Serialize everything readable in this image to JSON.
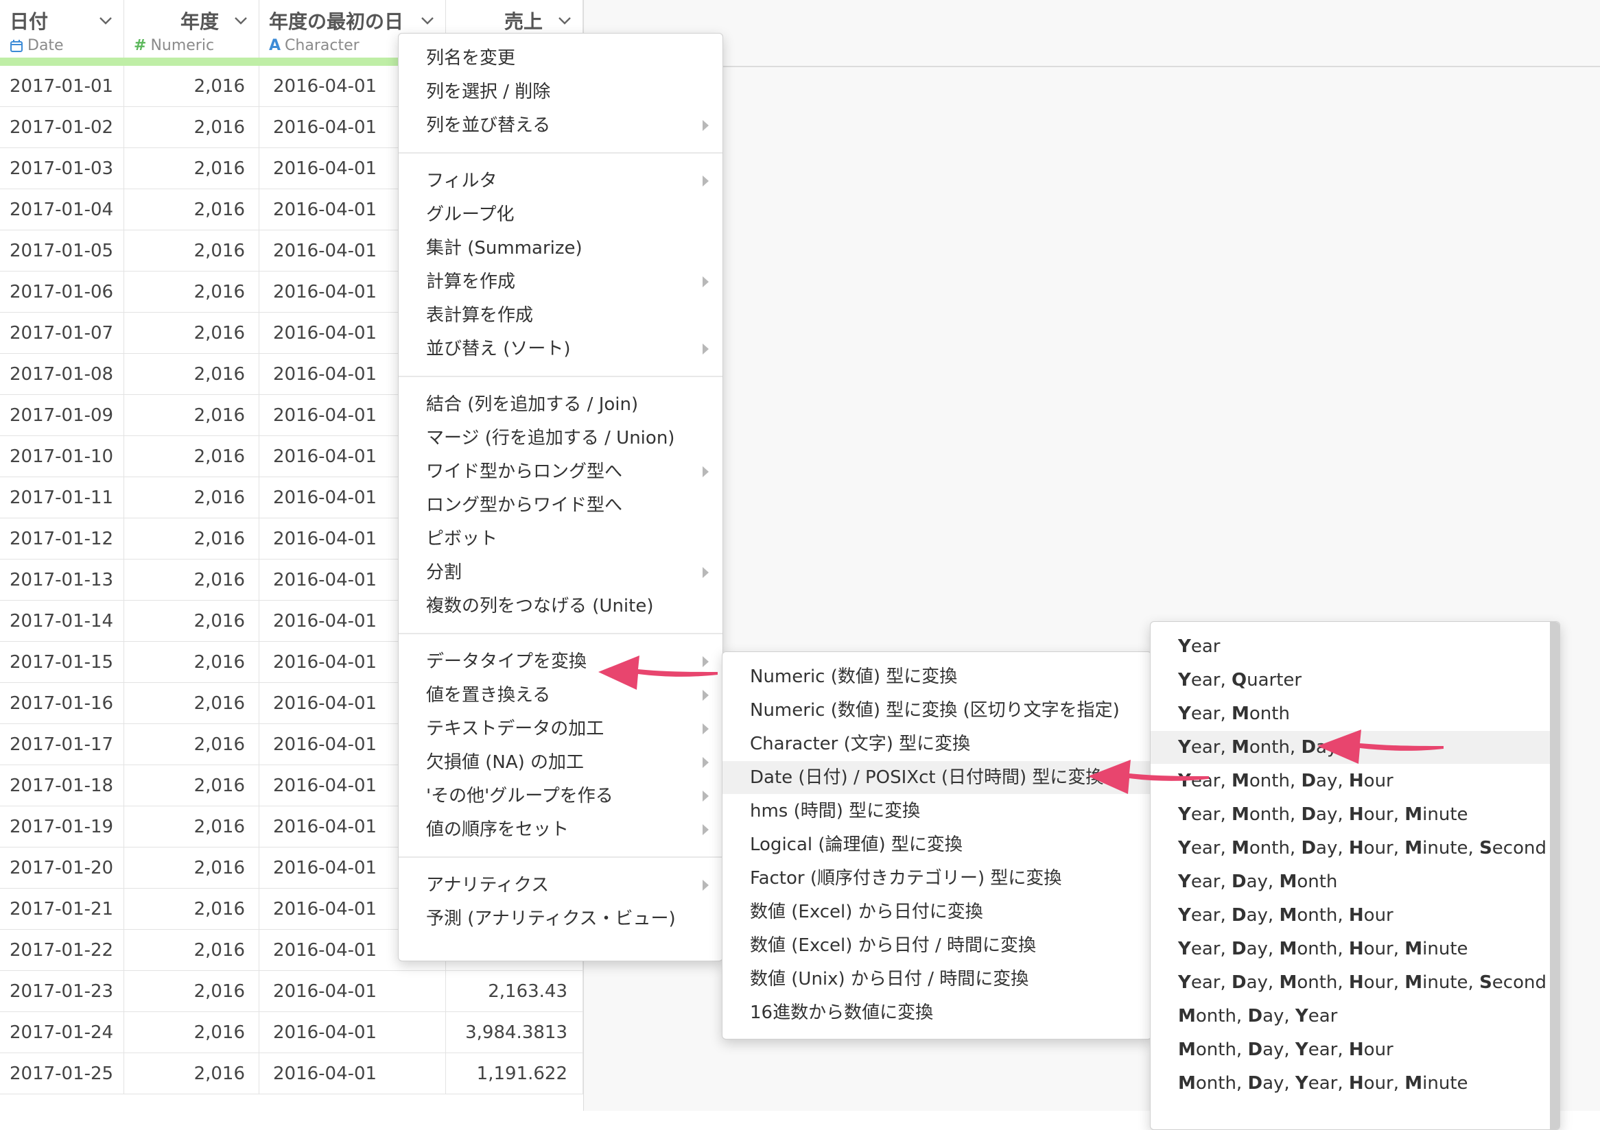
{
  "table": {
    "columns": [
      {
        "name": "日付",
        "type": "Date",
        "type_icon": "calendar-icon"
      },
      {
        "name": "年度",
        "type": "Numeric",
        "type_icon": "hash-icon"
      },
      {
        "name": "年度の最初の日",
        "type": "Character",
        "type_icon": "character-a-icon"
      },
      {
        "name": "売上",
        "type": ""
      }
    ],
    "rows": [
      [
        "2017-01-01",
        "2,016",
        "2016-04-01",
        ""
      ],
      [
        "2017-01-02",
        "2,016",
        "2016-04-01",
        ""
      ],
      [
        "2017-01-03",
        "2,016",
        "2016-04-01",
        ""
      ],
      [
        "2017-01-04",
        "2,016",
        "2016-04-01",
        ""
      ],
      [
        "2017-01-05",
        "2,016",
        "2016-04-01",
        ""
      ],
      [
        "2017-01-06",
        "2,016",
        "2016-04-01",
        ""
      ],
      [
        "2017-01-07",
        "2,016",
        "2016-04-01",
        ""
      ],
      [
        "2017-01-08",
        "2,016",
        "2016-04-01",
        ""
      ],
      [
        "2017-01-09",
        "2,016",
        "2016-04-01",
        ""
      ],
      [
        "2017-01-10",
        "2,016",
        "2016-04-01",
        ""
      ],
      [
        "2017-01-11",
        "2,016",
        "2016-04-01",
        ""
      ],
      [
        "2017-01-12",
        "2,016",
        "2016-04-01",
        ""
      ],
      [
        "2017-01-13",
        "2,016",
        "2016-04-01",
        ""
      ],
      [
        "2017-01-14",
        "2,016",
        "2016-04-01",
        ""
      ],
      [
        "2017-01-15",
        "2,016",
        "2016-04-01",
        ""
      ],
      [
        "2017-01-16",
        "2,016",
        "2016-04-01",
        ""
      ],
      [
        "2017-01-17",
        "2,016",
        "2016-04-01",
        ""
      ],
      [
        "2017-01-18",
        "2,016",
        "2016-04-01",
        ""
      ],
      [
        "2017-01-19",
        "2,016",
        "2016-04-01",
        ""
      ],
      [
        "2017-01-20",
        "2,016",
        "2016-04-01",
        ""
      ],
      [
        "2017-01-21",
        "2,016",
        "2016-04-01",
        ""
      ],
      [
        "2017-01-22",
        "2,016",
        "2016-04-01",
        ""
      ],
      [
        "2017-01-23",
        "2,016",
        "2016-04-01",
        "2,163.43"
      ],
      [
        "2017-01-24",
        "2,016",
        "2016-04-01",
        "3,984.3813"
      ],
      [
        "2017-01-25",
        "2,016",
        "2016-04-01",
        "1,191.622"
      ]
    ]
  },
  "column_menu": {
    "groups": [
      [
        {
          "label": "列名を変更",
          "submenu": false
        },
        {
          "label": "列を選択 / 削除",
          "submenu": false
        },
        {
          "label": "列を並び替える",
          "submenu": true
        }
      ],
      [
        {
          "label": "フィルタ",
          "submenu": true
        },
        {
          "label": "グループ化",
          "submenu": false
        },
        {
          "label": "集計 (Summarize)",
          "submenu": false
        },
        {
          "label": "計算を作成",
          "submenu": true
        },
        {
          "label": "表計算を作成",
          "submenu": false
        },
        {
          "label": "並び替え (ソート)",
          "submenu": true
        }
      ],
      [
        {
          "label": "結合 (列を追加する / Join)",
          "submenu": false
        },
        {
          "label": "マージ (行を追加する / Union)",
          "submenu": false
        },
        {
          "label": "ワイド型からロング型へ",
          "submenu": true
        },
        {
          "label": "ロング型からワイド型へ",
          "submenu": false
        },
        {
          "label": "ピボット",
          "submenu": false
        },
        {
          "label": "分割",
          "submenu": true
        },
        {
          "label": "複数の列をつなげる (Unite)",
          "submenu": false
        }
      ],
      [
        {
          "label": "データタイプを変換",
          "submenu": true
        },
        {
          "label": "値を置き換える",
          "submenu": true
        },
        {
          "label": "テキストデータの加工",
          "submenu": true
        },
        {
          "label": "欠損値 (NA) の加工",
          "submenu": true
        },
        {
          "label": "'その他'グループを作る",
          "submenu": true
        },
        {
          "label": "値の順序をセット",
          "submenu": true
        }
      ],
      [
        {
          "label": "アナリティクス",
          "submenu": true
        },
        {
          "label": "予測 (アナリティクス・ビュー)",
          "submenu": false
        }
      ]
    ]
  },
  "convert_menu": {
    "items": [
      "Numeric (数値) 型に変換",
      "Numeric (数値) 型に変換 (区切り文字を指定)",
      "Character (文字) 型に変換",
      "Date (日付) / POSIXct (日付時間) 型に変換",
      "hms (時間) 型に変換",
      "Logical (論理値) 型に変換",
      "Factor (順序付きカテゴリー) 型に変換",
      "数値 (Excel) から日付に変換",
      "数値 (Excel) から日付 / 時間に変換",
      "数値 (Unix) から日付 / 時間に変換",
      "16進数から数値に変換"
    ],
    "highlighted_index": 3
  },
  "date_format_menu": {
    "items": [
      "Year",
      "Year, Quarter",
      "Year, Month",
      "Year, Month, Day",
      "Year, Month, Day, Hour",
      "Year, Month, Day, Hour, Minute",
      "Year, Month, Day, Hour, Minute, Second",
      "Year, Day, Month",
      "Year, Day, Month, Hour",
      "Year, Day, Month, Hour, Minute",
      "Year, Day, Month, Hour, Minute, Second",
      "Month, Day, Year",
      "Month, Day, Year, Hour",
      "Month, Day, Year, Hour, Minute"
    ],
    "highlighted_index": 3
  },
  "colors": {
    "annotation_arrow": "#e8456e",
    "active_column_accent": "#f08a3c",
    "column_fill_bar": "#bfeea6",
    "date_icon": "#3d8bd6",
    "numeric_icon": "#5cb85c",
    "character_icon": "#3d8bd6"
  }
}
